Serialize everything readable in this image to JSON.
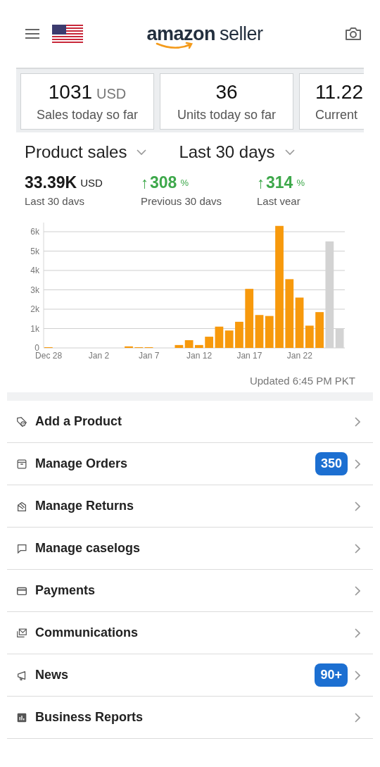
{
  "header": {
    "logo": {
      "brand": "amazon",
      "product": "seller"
    }
  },
  "summary_cards": [
    {
      "value": "1031",
      "unit": "USD",
      "label": "Sales today so far"
    },
    {
      "value": "36",
      "label": "Units today so far"
    },
    {
      "value": "11.22",
      "label": "Current"
    }
  ],
  "filters": [
    {
      "label": "Product sales"
    },
    {
      "label": "Last 30 days"
    }
  ],
  "stats": [
    {
      "kind": "total",
      "value": "33.39K",
      "unit": "USD",
      "label": "Last 30 davs"
    },
    {
      "kind": "change",
      "arrow": "↑",
      "value": "308",
      "unit": "%",
      "label": "Previous 30 davs"
    },
    {
      "kind": "change",
      "arrow": "↑",
      "value": "314",
      "unit": "%",
      "label": "Last vear"
    }
  ],
  "chart": {
    "chart_data": {
      "type": "bar",
      "grid": true,
      "categories": [
        "Dec 28",
        null,
        null,
        null,
        null,
        "Jan 2",
        null,
        null,
        null,
        null,
        "Jan 7",
        null,
        null,
        null,
        null,
        "Jan 12",
        null,
        null,
        null,
        null,
        "Jan 17",
        null,
        null,
        null,
        null,
        "Jan 22",
        null,
        null,
        null,
        null
      ],
      "series": [
        {
          "color": "#f7990c",
          "values": [
            10,
            0,
            0,
            0,
            0,
            0,
            0,
            0,
            80,
            20,
            10,
            0,
            0,
            150,
            400,
            150,
            580,
            1100,
            900,
            1350,
            3050,
            1700,
            1650,
            6300,
            3550,
            2600,
            1150,
            1850,
            null,
            null
          ]
        },
        {
          "color": "#d3d3d3",
          "values": [
            null,
            null,
            null,
            null,
            null,
            null,
            null,
            null,
            null,
            null,
            null,
            null,
            null,
            null,
            null,
            null,
            null,
            null,
            null,
            null,
            null,
            null,
            null,
            null,
            null,
            null,
            null,
            null,
            5500,
            1000
          ]
        }
      ],
      "ylim": [
        0,
        6500
      ],
      "yticks": [
        {
          "value": 0,
          "label": "0"
        },
        {
          "value": 1000,
          "label": "1k"
        },
        {
          "value": 2000,
          "label": "2k"
        },
        {
          "value": 3000,
          "label": "3k"
        },
        {
          "value": 4000,
          "label": "4k"
        },
        {
          "value": 5000,
          "label": "5k"
        },
        {
          "value": 6000,
          "label": "6k"
        }
      ]
    },
    "updated": "Updated 6:45 PM PKT"
  },
  "menu": [
    {
      "label": "Add a Product"
    },
    {
      "label": "Manage Orders",
      "badge": "350"
    },
    {
      "label": "Manage Returns"
    },
    {
      "label": "Manage caselogs"
    },
    {
      "label": "Payments"
    },
    {
      "label": "Communications"
    },
    {
      "label": "News",
      "badge": "90+"
    },
    {
      "label": "Business Reports"
    }
  ]
}
